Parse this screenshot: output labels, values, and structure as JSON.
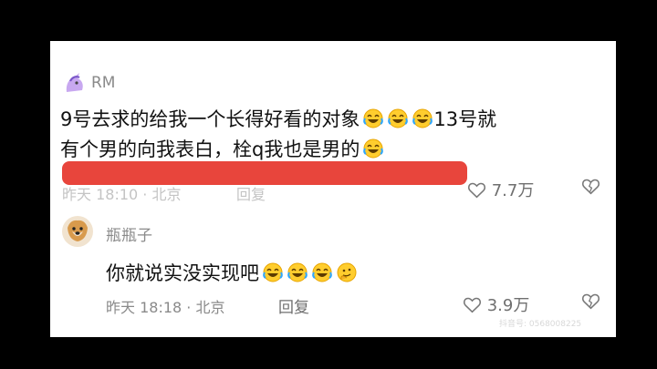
{
  "comments": [
    {
      "username": "RM",
      "text_line1": "9号去求的给我一个长得好看的对象",
      "text_line1_suffix": "13号就",
      "text_line2": "有个男的向我表白，栓q我也是男的",
      "meta_time_location": "昨天 18:10 · 北京",
      "reply_label": "回复",
      "likes": "7.7万",
      "emoji_count_line1": 3,
      "emoji_count_line2": 1
    },
    {
      "username": "瓶瓶子",
      "text": "你就说实没实现吧",
      "time": "昨天 18:18 · 北京",
      "reply_label": "回复",
      "likes": "3.9万",
      "emoji_set": [
        "laugh-cry",
        "laugh-cry",
        "laugh-cry",
        "thinking"
      ]
    }
  ],
  "colors": {
    "redacted_bar": "#e8453c",
    "accent_text": "#111111",
    "muted_text": "#8a8a8a",
    "frame": "#000000"
  },
  "icons": [
    "unicorn-avatar-icon",
    "dog-avatar-icon",
    "heart-outline-icon",
    "dislike-heart-icon",
    "laugh-cry-emoji",
    "thinking-emoji"
  ],
  "watermark": "抖音号: 0568008225"
}
